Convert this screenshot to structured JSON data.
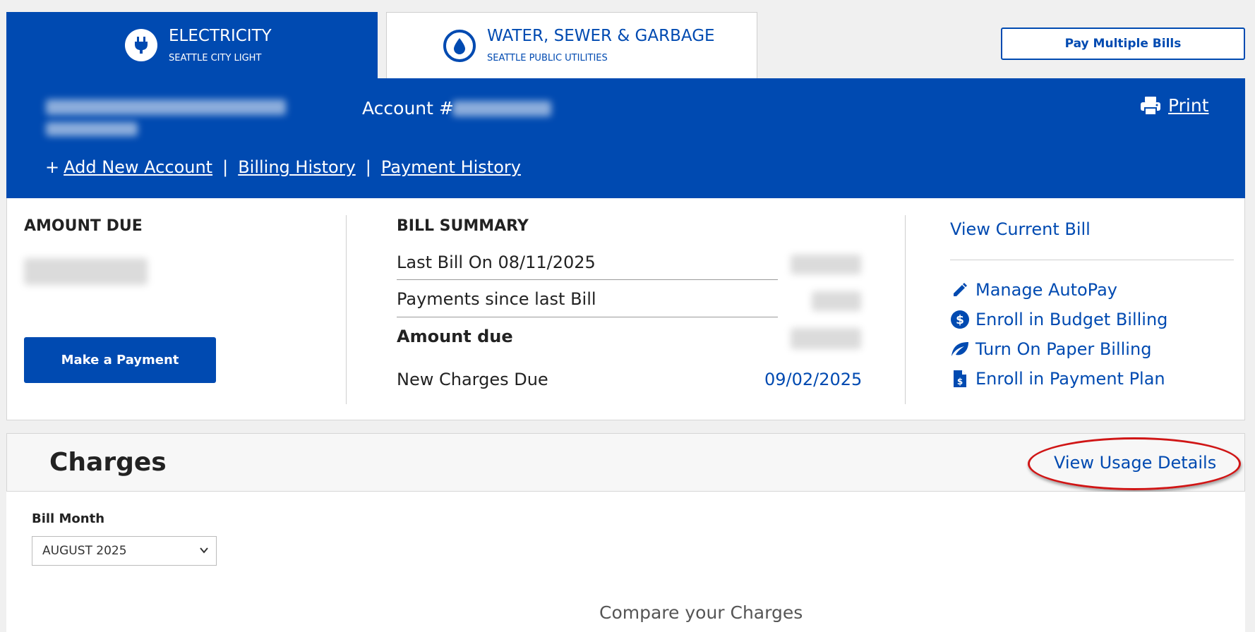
{
  "tabs": [
    {
      "title": "ELECTRICITY",
      "subtitle": "SEATTLE CITY LIGHT",
      "icon": "plug-icon"
    },
    {
      "title": "WATER, SEWER & GARBAGE",
      "subtitle": "SEATTLE PUBLIC UTILITIES",
      "icon": "water-drop-icon"
    }
  ],
  "pay_multiple_label": "Pay Multiple Bills",
  "account": {
    "label": "Account #",
    "print_label": "Print",
    "add_prefix": "+",
    "add_account": "Add New Account",
    "separator": "|",
    "billing_history": "Billing History",
    "payment_history": "Payment History"
  },
  "amount_due": {
    "heading": "AMOUNT DUE",
    "make_payment": "Make a Payment"
  },
  "bill_summary": {
    "heading": "BILL SUMMARY",
    "last_bill": "Last Bill On 08/11/2025",
    "payments_since": "Payments since last Bill",
    "amount_due": "Amount due",
    "new_charges_due": "New Charges Due",
    "new_charges_date": "09/02/2025"
  },
  "actions": {
    "view_current_bill": "View Current Bill",
    "manage_autopay": "Manage AutoPay",
    "budget_billing": "Enroll in Budget Billing",
    "paper_billing": "Turn On Paper Billing",
    "payment_plan": "Enroll in Payment Plan"
  },
  "charges": {
    "title": "Charges",
    "view_usage": "View Usage Details",
    "bill_month_label": "Bill Month",
    "bill_month_value": "AUGUST 2025",
    "compare_title": "Compare your Charges"
  },
  "colors": {
    "brand_blue": "#004ab1",
    "annotation_red": "#d01515"
  }
}
